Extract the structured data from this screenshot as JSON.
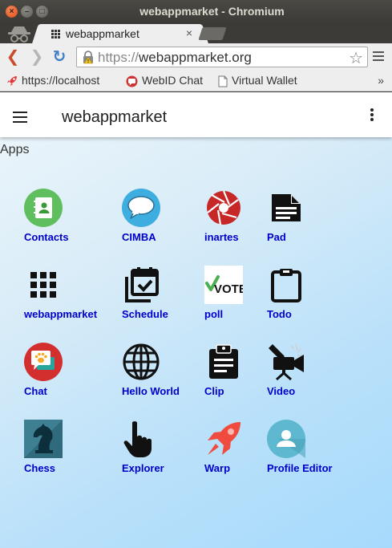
{
  "window": {
    "title": "webappmarket - Chromium"
  },
  "tab": {
    "title": "webappmarket",
    "close": "×"
  },
  "toolbar": {
    "url_scheme": "https://",
    "url_host": "webappmarket.org"
  },
  "bookmarks": [
    {
      "label": "https://localhost",
      "icon": "rocket-icon"
    },
    {
      "label": "WebID Chat",
      "icon": "chat-icon"
    },
    {
      "label": "Virtual Wallet",
      "icon": "page-icon"
    }
  ],
  "bookmarks_more": "»",
  "appbar": {
    "title": "webappmarket"
  },
  "section_title": "Apps",
  "apps": [
    {
      "label": "Contacts",
      "icon": "contacts-icon"
    },
    {
      "label": "CIMBA",
      "icon": "speech-bubble-icon"
    },
    {
      "label": "inartes",
      "icon": "shutter-icon"
    },
    {
      "label": "Pad",
      "icon": "document-icon"
    },
    {
      "label": "webappmarket",
      "icon": "grid-icon"
    },
    {
      "label": "Schedule",
      "icon": "calendar-check-icon"
    },
    {
      "label": "poll",
      "icon": "vote-icon",
      "icon_text": "VOTE"
    },
    {
      "label": "Todo",
      "icon": "clipboard-icon"
    },
    {
      "label": "Chat",
      "icon": "paw-chat-icon"
    },
    {
      "label": "Hello World",
      "icon": "globe-icon"
    },
    {
      "label": "Clip",
      "icon": "clipboard-list-icon"
    },
    {
      "label": "Video",
      "icon": "video-camera-icon"
    },
    {
      "label": "Chess",
      "icon": "chess-knight-icon"
    },
    {
      "label": "Explorer",
      "icon": "pointer-hand-icon"
    },
    {
      "label": "Warp",
      "icon": "rocket-icon"
    },
    {
      "label": "Profile Editor",
      "icon": "profile-icon"
    }
  ],
  "colors": {
    "link": "#0000cc",
    "chromium_dark": "#3c3b37",
    "toolbar": "#eeeeee"
  }
}
